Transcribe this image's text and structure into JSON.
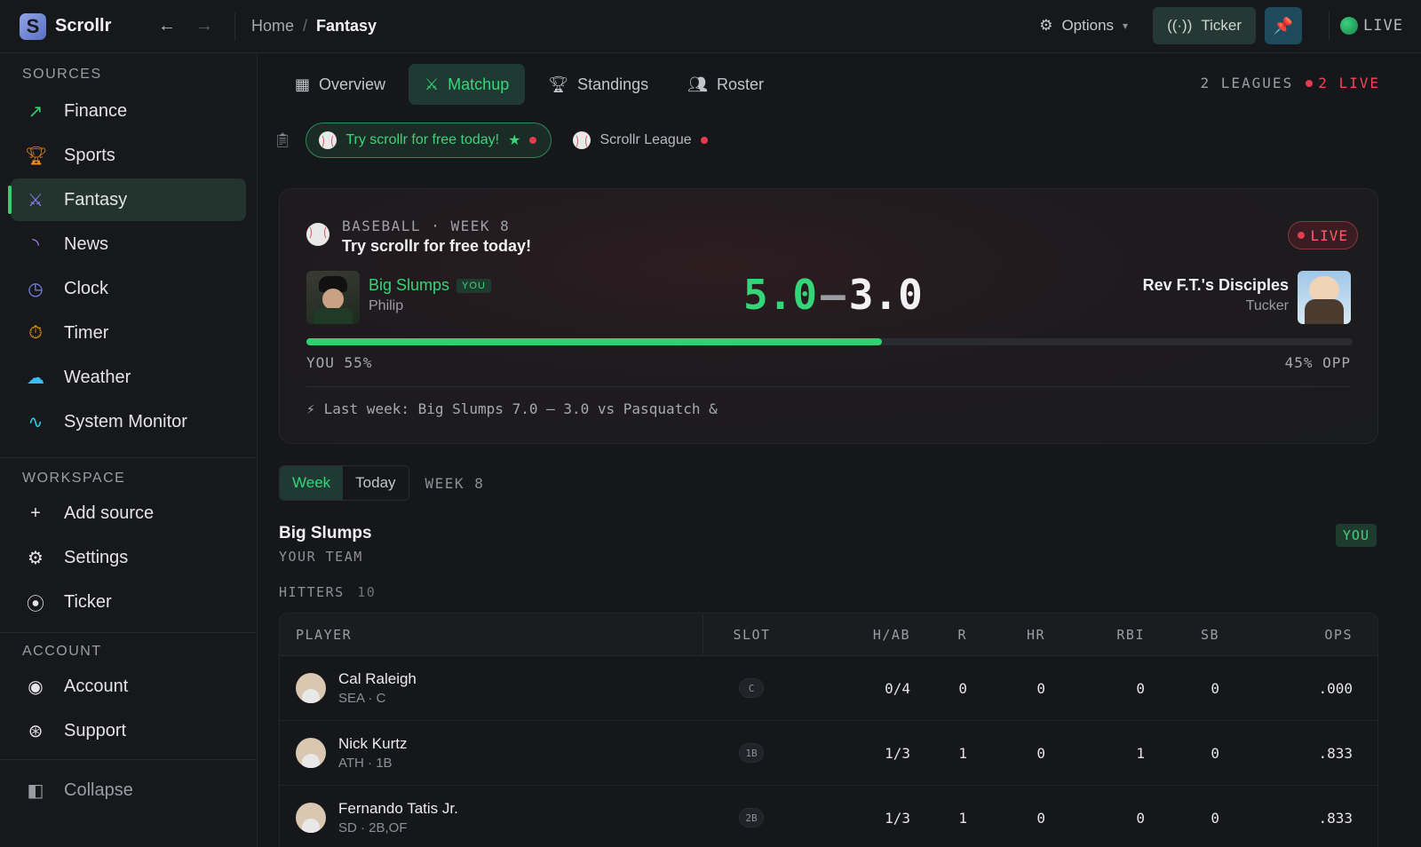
{
  "app": {
    "name": "Scrollr",
    "logo_letter": "S"
  },
  "breadcrumb": {
    "home": "Home",
    "separator": "/",
    "current": "Fantasy"
  },
  "topbar": {
    "options_label": "Options",
    "ticker_label": "Ticker",
    "live_label": "LIVE"
  },
  "sidebar": {
    "sources_title": "SOURCES",
    "sources": [
      {
        "label": "Finance",
        "icon": "trending-up-icon",
        "color": "#2fd26e"
      },
      {
        "label": "Sports",
        "icon": "trophy-icon",
        "color": "#f08a24"
      },
      {
        "label": "Fantasy",
        "icon": "swords-icon",
        "color": "#8b7cf6",
        "active": true
      },
      {
        "label": "News",
        "icon": "rss-icon",
        "color": "#a78bfa"
      },
      {
        "label": "Clock",
        "icon": "clock-icon",
        "color": "#7c8cf8"
      },
      {
        "label": "Timer",
        "icon": "timer-icon",
        "color": "#f59e0b"
      },
      {
        "label": "Weather",
        "icon": "weather-icon",
        "color": "#38bdf8"
      },
      {
        "label": "System Monitor",
        "icon": "activity-icon",
        "color": "#22d3ee"
      }
    ],
    "workspace_title": "WORKSPACE",
    "workspace": [
      {
        "label": "Add source",
        "icon": "plus-icon"
      },
      {
        "label": "Settings",
        "icon": "gear-icon"
      },
      {
        "label": "Ticker",
        "icon": "broadcast-icon"
      }
    ],
    "account_title": "ACCOUNT",
    "account": [
      {
        "label": "Account",
        "icon": "user-circle-icon"
      },
      {
        "label": "Support",
        "icon": "lifebuoy-icon"
      }
    ],
    "collapse_label": "Collapse"
  },
  "tabs": [
    {
      "label": "Overview",
      "icon": "grid-icon"
    },
    {
      "label": "Matchup",
      "icon": "swords-icon",
      "active": true
    },
    {
      "label": "Standings",
      "icon": "trophy-icon"
    },
    {
      "label": "Roster",
      "icon": "users-icon"
    }
  ],
  "leagues_info": {
    "leagues": "2 LEAGUES",
    "live": "2 LIVE"
  },
  "league_pills": [
    {
      "label": "Try scrollr for free today!",
      "active": true
    },
    {
      "label": "Scrollr League",
      "active": false
    }
  ],
  "matchup": {
    "sport_week": "BASEBALL · WEEK 8",
    "league": "Try scrollr for free today!",
    "live_label": "LIVE",
    "my_team": {
      "name": "Big Slumps",
      "tag": "YOU",
      "owner": "Philip",
      "score": "5.0"
    },
    "opp_team": {
      "name": "Rev F.T.'s Disciples",
      "owner": "Tucker",
      "score": "3.0"
    },
    "score_sep": "–",
    "win_prob_you": 0.55,
    "prob_you_label": "YOU 55%",
    "prob_opp_label": "45% OPP",
    "last_week": "Last week: Big Slumps 7.0 – 3.0 vs Pasquatch &"
  },
  "period": {
    "options": [
      "Week",
      "Today"
    ],
    "active": "Week",
    "week_label": "WEEK 8"
  },
  "team_section": {
    "name": "Big Slumps",
    "subtitle": "YOUR TEAM",
    "badge": "YOU",
    "hitters_label": "HITTERS",
    "hitters_count": "10"
  },
  "table": {
    "headers": [
      "PLAYER",
      "SLOT",
      "H/AB",
      "R",
      "HR",
      "RBI",
      "SB",
      "OPS"
    ],
    "rows": [
      {
        "name": "Cal Raleigh",
        "meta": "SEA · C",
        "slot": "C",
        "hab": "0/4",
        "r": "0",
        "hr": "0",
        "rbi": "0",
        "sb": "0",
        "ops": ".000"
      },
      {
        "name": "Nick Kurtz",
        "meta": "ATH · 1B",
        "slot": "1B",
        "hab": "1/3",
        "r": "1",
        "hr": "0",
        "rbi": "1",
        "sb": "0",
        "ops": ".833"
      },
      {
        "name": "Fernando Tatis Jr.",
        "meta": "SD · 2B,OF",
        "slot": "2B",
        "hab": "1/3",
        "r": "1",
        "hr": "0",
        "rbi": "0",
        "sb": "0",
        "ops": ".833"
      }
    ]
  }
}
